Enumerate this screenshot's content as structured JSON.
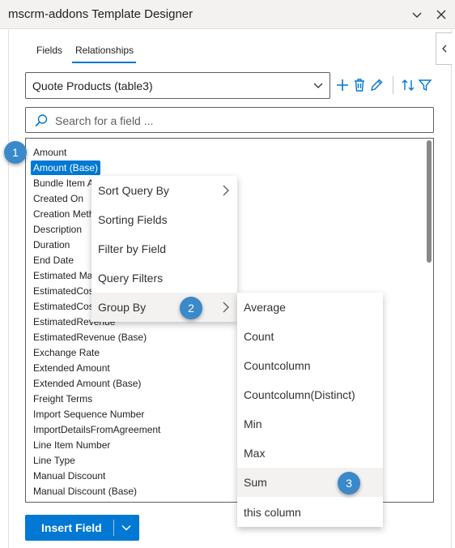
{
  "window": {
    "title": "mscrm-addons Template Designer"
  },
  "tabs": [
    {
      "label": "Fields",
      "active": false
    },
    {
      "label": "Relationships",
      "active": true
    }
  ],
  "relationship_select": {
    "value": "Quote Products (table3)"
  },
  "toolbar": {
    "icons": [
      "add-icon",
      "delete-icon",
      "edit-icon",
      "sort-icon",
      "filter-icon"
    ]
  },
  "search": {
    "placeholder": "Search for a field ..."
  },
  "fields": [
    {
      "label": "Amount",
      "selected": false
    },
    {
      "label": "Amount (Base)",
      "selected": true
    },
    {
      "label": "Bundle Item A",
      "selected": false
    },
    {
      "label": "Created On",
      "selected": false
    },
    {
      "label": "Creation Meth",
      "selected": false
    },
    {
      "label": "Description",
      "selected": false
    },
    {
      "label": "Duration",
      "selected": false
    },
    {
      "label": "End Date",
      "selected": false
    },
    {
      "label": "Estimated Ma",
      "selected": false
    },
    {
      "label": "EstimatedCos",
      "selected": false
    },
    {
      "label": "EstimatedCos",
      "selected": false
    },
    {
      "label": "EstimatedRevenue",
      "selected": false
    },
    {
      "label": "EstimatedRevenue (Base)",
      "selected": false
    },
    {
      "label": "Exchange Rate",
      "selected": false
    },
    {
      "label": "Extended Amount",
      "selected": false
    },
    {
      "label": "Extended Amount (Base)",
      "selected": false
    },
    {
      "label": "Freight Terms",
      "selected": false
    },
    {
      "label": "Import Sequence Number",
      "selected": false
    },
    {
      "label": "ImportDetailsFromAgreement",
      "selected": false
    },
    {
      "label": "Line Item Number",
      "selected": false
    },
    {
      "label": "Line Type",
      "selected": false
    },
    {
      "label": "Manual Discount",
      "selected": false
    },
    {
      "label": "Manual Discount (Base)",
      "selected": false
    }
  ],
  "context_menu": {
    "items": [
      {
        "label": "Sort Query By",
        "has_submenu": true
      },
      {
        "label": "Sorting Fields",
        "has_submenu": false
      },
      {
        "label": "Filter by Field",
        "has_submenu": false
      },
      {
        "label": "Query Filters",
        "has_submenu": false
      },
      {
        "label": "Group By",
        "has_submenu": true,
        "highlighted": true
      }
    ]
  },
  "group_by_submenu": {
    "items": [
      {
        "label": "Average"
      },
      {
        "label": "Count"
      },
      {
        "label": "Countcolumn"
      },
      {
        "label": "Countcolumn(Distinct)"
      },
      {
        "label": "Min"
      },
      {
        "label": "Max"
      },
      {
        "label": "Sum",
        "highlighted": true
      },
      {
        "label": "this column"
      }
    ]
  },
  "step_badges": [
    "1",
    "2",
    "3"
  ],
  "insert_button": {
    "label": "Insert Field"
  },
  "colors": {
    "accent": "#0078d4",
    "badge": "#3a89c9",
    "hover": "#f3f2f1"
  }
}
